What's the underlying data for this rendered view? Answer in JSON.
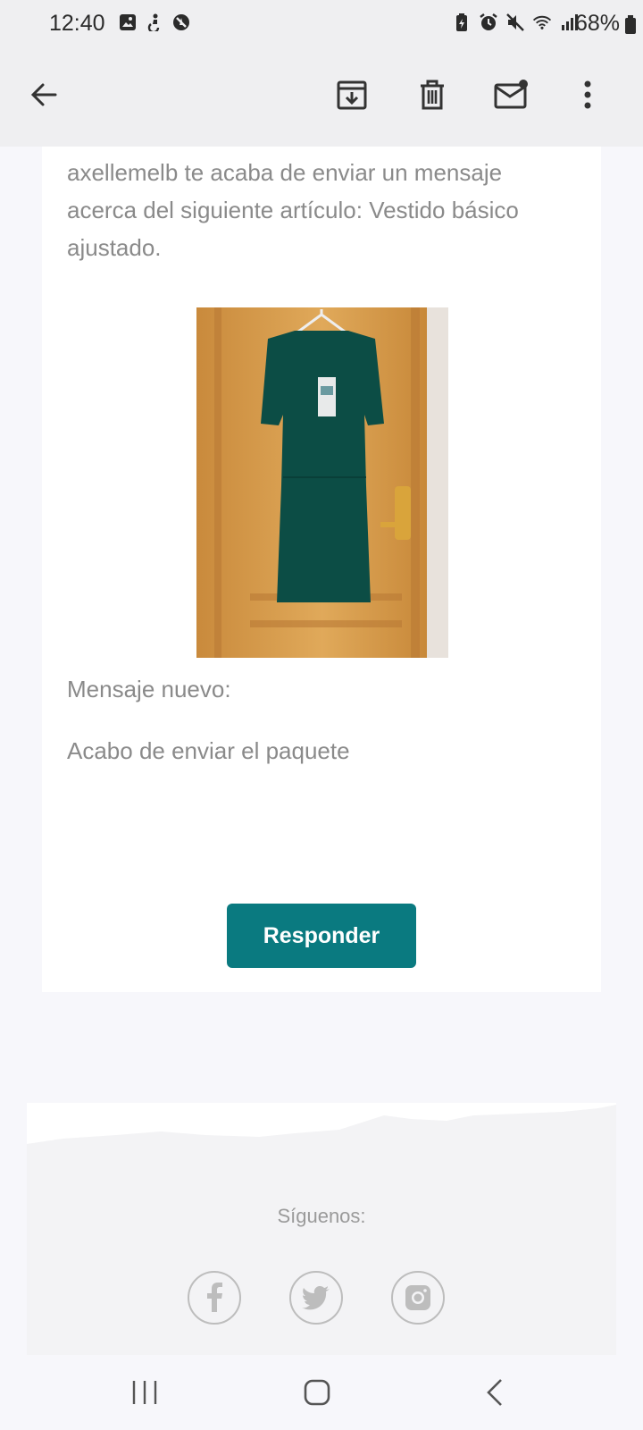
{
  "status_bar": {
    "time": "12:40",
    "battery_percent": "68%",
    "icons_left": [
      "image-icon",
      "accessibility-icon",
      "blocked-icon"
    ],
    "icons_right": [
      "battery-saver-icon",
      "alarm-icon",
      "mute-icon",
      "wifi-icon",
      "signal-icon",
      "battery-icon"
    ]
  },
  "app_bar": {
    "actions": [
      "back-arrow-icon",
      "archive-icon",
      "delete-icon",
      "mark-unread-icon",
      "more-options-icon"
    ]
  },
  "email": {
    "intro_text": "axellemelb te acaba de enviar un mensaje acerca del siguiente artículo: Vestido básico ajustado.",
    "new_message_label": "Mensaje nuevo:",
    "message_text": "Acabo de enviar el paquete",
    "reply_button": "Responder"
  },
  "footer": {
    "follow_label": "Síguenos:",
    "social": [
      "facebook-icon",
      "twitter-icon",
      "instagram-icon"
    ]
  },
  "colors": {
    "accent": "#0a7a80",
    "muted_text": "#8a8a8a",
    "bar_background": "#efeff1"
  }
}
